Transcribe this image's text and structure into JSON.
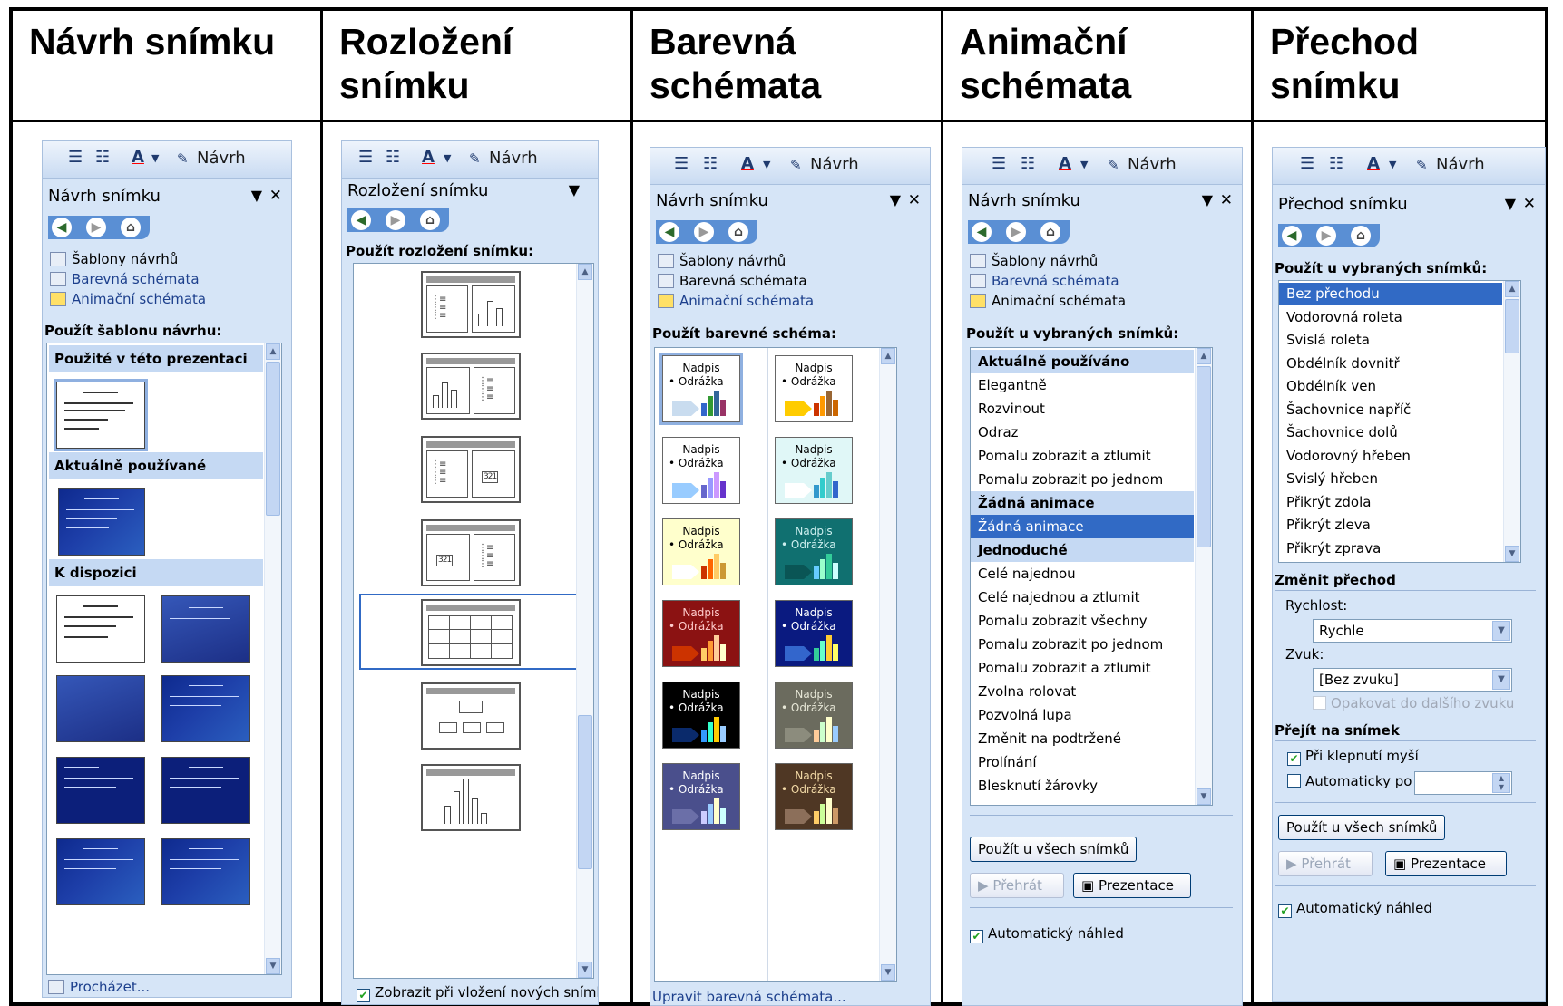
{
  "columns": [
    {
      "heading": "Návrh snímku"
    },
    {
      "heading": "Rozložení snímku"
    },
    {
      "heading": "Barevná schémata"
    },
    {
      "heading": "Animační schémata"
    },
    {
      "heading": "Přechod snímku"
    }
  ],
  "toolbar": {
    "design_label": "Návrh"
  },
  "design_panel": {
    "title": "Návrh snímku",
    "links": [
      "Šablony návrhů",
      "Barevná schémata",
      "Animační schémata"
    ],
    "section": "Použít šablonu návrhu:",
    "groups": [
      "Použité v této prezentaci",
      "Aktuálně používané",
      "K dispozici"
    ],
    "browse": "Procházet..."
  },
  "layout_panel": {
    "title": "Rozložení snímku",
    "section": "Použít rozložení snímku:",
    "checkbox": "Zobrazit při vložení nových snímků"
  },
  "color_panel": {
    "title": "Návrh snímku",
    "links": [
      "Šablony návrhů",
      "Barevná schémata",
      "Animační schémata"
    ],
    "section": "Použít barevné schéma:",
    "sample_title": "Nadpis",
    "sample_bullet": "• Odrážka",
    "edit_link": "Upravit barevná schémata...",
    "schemes": [
      {
        "bg": "#ffffff",
        "fg": "#000000",
        "arrow": "#c9dcef",
        "bars": [
          "#3366cc",
          "#339933",
          "#336699",
          "#993366"
        ]
      },
      {
        "bg": "#ffffff",
        "fg": "#000000",
        "arrow": "#ffcc00",
        "bars": [
          "#cc3300",
          "#ff9900",
          "#996633",
          "#cc6600"
        ]
      },
      {
        "bg": "#ffffff",
        "fg": "#000000",
        "arrow": "#99ccff",
        "bars": [
          "#6666cc",
          "#9999ff",
          "#cc99ff",
          "#6633cc"
        ]
      },
      {
        "bg": "#e0f7f7",
        "fg": "#000000",
        "arrow": "#ffffff",
        "bars": [
          "#3399cc",
          "#33cccc",
          "#66cccc",
          "#3366cc"
        ]
      },
      {
        "bg": "#ffffcc",
        "fg": "#000000",
        "arrow": "#ffffff",
        "bars": [
          "#cc3300",
          "#ff6600",
          "#ffcc66",
          "#cc9933"
        ]
      },
      {
        "bg": "#107070",
        "fg": "#cceeee",
        "arrow": "#0a5555",
        "bars": [
          "#66ccff",
          "#99ffcc",
          "#33cc99",
          "#ccffff"
        ]
      },
      {
        "bg": "#8b1212",
        "fg": "#ffcccc",
        "arrow": "#cc3300",
        "bars": [
          "#ffcc66",
          "#ff9933",
          "#ffcc99",
          "#ffffcc"
        ]
      },
      {
        "bg": "#0a1a80",
        "fg": "#ffffff",
        "arrow": "#3366cc",
        "bars": [
          "#33cc99",
          "#66ffcc",
          "#ffcc33",
          "#ffff66"
        ]
      },
      {
        "bg": "#000000",
        "fg": "#ffffff",
        "arrow": "#0a2a6b",
        "bars": [
          "#3399ff",
          "#33ffcc",
          "#ffcc00",
          "#99ccff"
        ]
      },
      {
        "bg": "#6b6b5e",
        "fg": "#e6e6d6",
        "arrow": "#8c8c7d",
        "bars": [
          "#ffcc99",
          "#ccffcc",
          "#ffffcc",
          "#99ccff"
        ]
      },
      {
        "bg": "#4a4f8c",
        "fg": "#ffffff",
        "arrow": "#6b6fa8",
        "bars": [
          "#ccccff",
          "#99ccff",
          "#ffffcc",
          "#ccffff"
        ]
      },
      {
        "bg": "#4f3724",
        "fg": "#f2d9a6",
        "arrow": "#8c6f5a",
        "bars": [
          "#ffcc66",
          "#ccff99",
          "#ffffcc",
          "#cc9966"
        ]
      }
    ]
  },
  "animation_panel": {
    "title": "Návrh snímku",
    "links": [
      "Šablony návrhů",
      "Barevná schémata",
      "Animační schémata"
    ],
    "section": "Použít u vybraných snímků:",
    "items": [
      {
        "label": "Aktuálně používáno",
        "type": "group"
      },
      {
        "label": "Elegantně",
        "type": "item"
      },
      {
        "label": "Rozvinout",
        "type": "item"
      },
      {
        "label": "Odraz",
        "type": "item"
      },
      {
        "label": "Pomalu zobrazit a ztlumit",
        "type": "item"
      },
      {
        "label": "Pomalu zobrazit po jednom",
        "type": "item"
      },
      {
        "label": "Žádná animace",
        "type": "group"
      },
      {
        "label": "Žádná animace",
        "type": "selected"
      },
      {
        "label": "Jednoduché",
        "type": "group"
      },
      {
        "label": "Celé najednou",
        "type": "item"
      },
      {
        "label": "Celé najednou a ztlumit",
        "type": "item"
      },
      {
        "label": "Pomalu zobrazit všechny",
        "type": "item"
      },
      {
        "label": "Pomalu zobrazit po jednom",
        "type": "item"
      },
      {
        "label": "Pomalu zobrazit a ztlumit",
        "type": "item"
      },
      {
        "label": "Zvolna rolovat",
        "type": "item"
      },
      {
        "label": "Pozvolná lupa",
        "type": "item"
      },
      {
        "label": "Změnit na podtržené",
        "type": "item"
      },
      {
        "label": "Prolínání",
        "type": "item"
      },
      {
        "label": "Blesknutí žárovky",
        "type": "item"
      }
    ],
    "apply_all": "Použít u všech snímků",
    "play": "Přehrát",
    "slideshow": "Prezentace",
    "autopreview": "Automatický náhled"
  },
  "transition_panel": {
    "title": "Přechod snímku",
    "section": "Použít u vybraných snímků:",
    "items": [
      "Bez přechodu",
      "Vodorovná roleta",
      "Svislá roleta",
      "Obdélník dovnitř",
      "Obdélník ven",
      "Šachovnice napříč",
      "Šachovnice dolů",
      "Vodorovný hřeben",
      "Svislý hřeben",
      "Přikrýt zdola",
      "Přikrýt zleva",
      "Přikrýt zprava"
    ],
    "modify": "Změnit přechod",
    "speed_label": "Rychlost:",
    "speed_value": "Rychle",
    "sound_label": "Zvuk:",
    "sound_value": "[Bez zvuku]",
    "loop_label": "Opakovat do dalšího zvuku",
    "advance": "Přejít na snímek",
    "on_click": "Při klepnutí myší",
    "auto_after": "Automaticky po",
    "apply_all": "Použít u všech snímků",
    "play": "Přehrát",
    "slideshow": "Prezentace",
    "autopreview": "Automatický náhled"
  }
}
